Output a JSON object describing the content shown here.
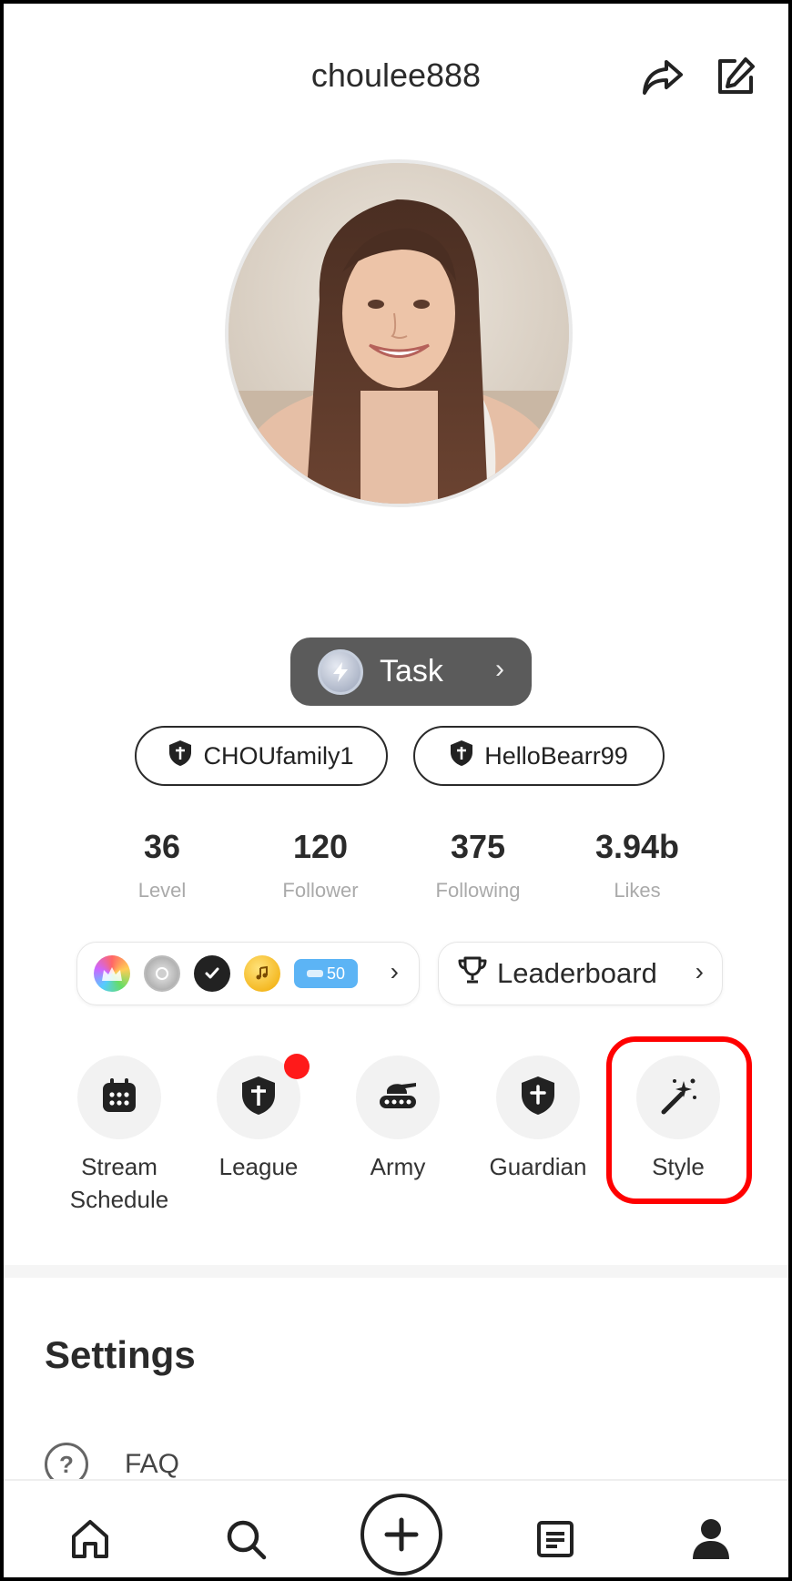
{
  "header": {
    "username": "choulee888",
    "share_icon": "share-icon",
    "edit_icon": "edit-icon"
  },
  "task_button": {
    "label": "Task",
    "icon": "lightning-badge-icon"
  },
  "chips": [
    {
      "label": "CHOUfamily1",
      "icon": "shield-icon"
    },
    {
      "label": "HelloBearr99",
      "icon": "shield-icon"
    }
  ],
  "stats": [
    {
      "value": "36",
      "label": "Level"
    },
    {
      "value": "120",
      "label": "Follower"
    },
    {
      "value": "375",
      "label": "Following"
    },
    {
      "value": "3.94b",
      "label": "Likes"
    }
  ],
  "badges": {
    "icons": [
      "rainbow-crown-icon",
      "silver-medal-icon",
      "verified-badge-icon",
      "music-coin-icon"
    ],
    "pill_label": "50"
  },
  "leaderboard": {
    "label": "Leaderboard",
    "icon": "trophy-icon"
  },
  "tools": [
    {
      "label": "Stream Schedule",
      "icon": "calendar-icon"
    },
    {
      "label": "League",
      "icon": "shield-icon",
      "notification": true
    },
    {
      "label": "Army",
      "icon": "tank-icon"
    },
    {
      "label": "Guardian",
      "icon": "guardian-shield-icon"
    },
    {
      "label": "Style",
      "icon": "magic-wand-icon",
      "highlighted": true
    }
  ],
  "settings": {
    "title": "Settings",
    "items": [
      {
        "label": "FAQ",
        "icon": "question-icon"
      }
    ]
  },
  "bottom_nav": [
    "home-icon",
    "search-icon",
    "plus-icon",
    "document-icon",
    "profile-icon"
  ],
  "colors": {
    "accent_highlight": "#ff0000",
    "task_bg": "#5b5b5b",
    "notification_dot": "#ff1a1a",
    "pill_blue": "#5cb4f5"
  }
}
